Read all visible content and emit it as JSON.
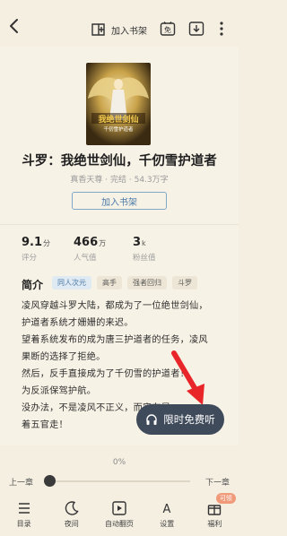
{
  "topbar": {
    "add_shelf_label": "加入书架",
    "free_icon_text": "免"
  },
  "book": {
    "title": "斗罗：我绝世剑仙，千仞雪护道者",
    "author": "真香天尊",
    "status": "完结",
    "word_count": "54.3万字",
    "cover_title": "我绝世剑仙",
    "cover_subtitle": "千仞雪护道者",
    "add_shelf_button": "加入书架"
  },
  "stats": [
    {
      "value": "9.1",
      "unit": "分",
      "label": "评分"
    },
    {
      "value": "466",
      "unit": "万",
      "label": "人气值"
    },
    {
      "value": "3",
      "unit": "k",
      "label": "粉丝值"
    }
  ],
  "intro": {
    "label": "简介",
    "tags": [
      "同人次元",
      "高手",
      "强者回归",
      "斗罗"
    ],
    "lines": [
      "凌风穿越斗罗大陆，都成为了一位绝世剑仙，",
      "护道者系统才姗姗的来迟。",
      "望着系统发布的成为唐三护道者的任务，凌风",
      "果断的选择了拒绝。",
      "然后，反手直接成为了千仞雪的护道者！",
      "为反派保驾护航。",
      "没办法，不是凌风不正义，而实在是",
      "着五官走！"
    ]
  },
  "listen_button": "限时免费听",
  "reader": {
    "progress": "0%",
    "progress_value": 0,
    "prev_chapter": "上一章",
    "next_chapter": "下一章"
  },
  "bottom_nav": [
    {
      "label": "目录"
    },
    {
      "label": "夜间"
    },
    {
      "label": "自动翻页"
    },
    {
      "label": "设置"
    },
    {
      "label": "福利",
      "badge": "可领"
    }
  ],
  "colors": {
    "background": "#f5efe2",
    "accent_blue": "#4a79a8",
    "listen_button": "#3f4a5a",
    "badge": "#f09a7a",
    "arrow": "#e8262a"
  }
}
